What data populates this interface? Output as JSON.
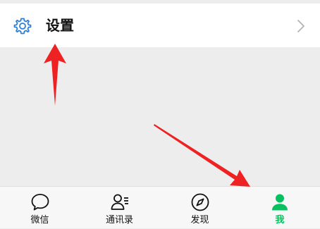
{
  "settings": {
    "label": "设置",
    "icon": "gear-icon",
    "chevron_icon": "chevron-right-icon"
  },
  "tabbar": {
    "active_color": "#07c160",
    "tabs": [
      {
        "label": "微信",
        "icon": "chat-bubble-icon",
        "active": false
      },
      {
        "label": "通讯录",
        "icon": "contacts-icon",
        "active": false
      },
      {
        "label": "发现",
        "icon": "compass-icon",
        "active": false
      },
      {
        "label": "我",
        "icon": "person-icon",
        "active": true
      }
    ]
  },
  "annotation_color": "#ee2222"
}
